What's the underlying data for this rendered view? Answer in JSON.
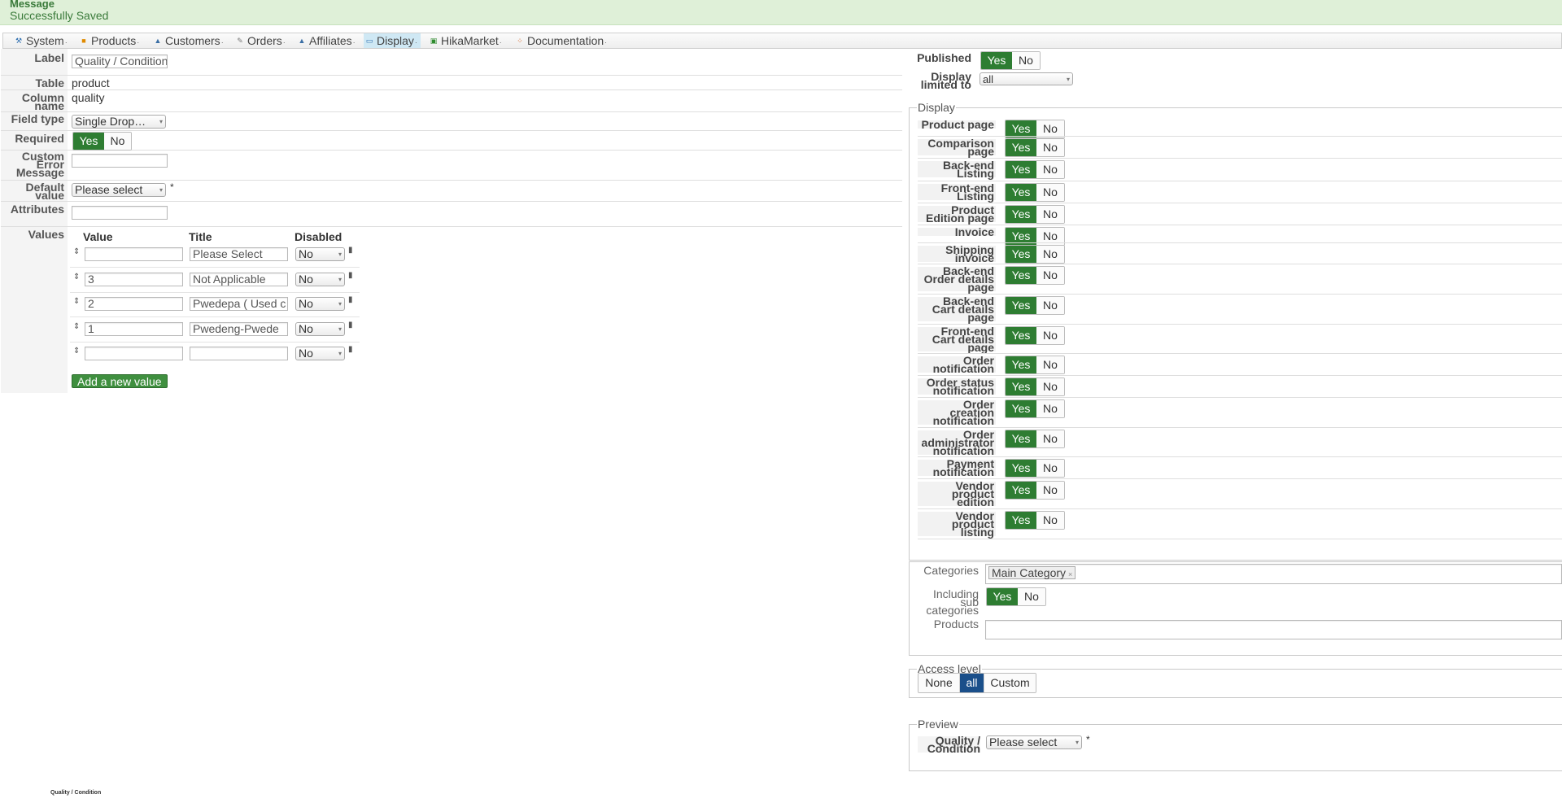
{
  "message": {
    "title": "Message",
    "text": "Successfully Saved"
  },
  "menu": [
    {
      "label": "System",
      "icon": "wrench-icon",
      "glyph": "⚒"
    },
    {
      "label": "Products",
      "icon": "box-icon",
      "glyph": "■"
    },
    {
      "label": "Customers",
      "icon": "user-icon",
      "glyph": "▲"
    },
    {
      "label": "Orders",
      "icon": "pencil-icon",
      "glyph": "✎"
    },
    {
      "label": "Affiliates",
      "icon": "people-icon",
      "glyph": "▲"
    },
    {
      "label": "Display",
      "icon": "monitor-icon",
      "glyph": "▭"
    },
    {
      "label": "HikaMarket",
      "icon": "market-icon",
      "glyph": "▣"
    },
    {
      "label": "Documentation",
      "icon": "help-icon",
      "glyph": "⁘"
    }
  ],
  "form": {
    "label_label": "Label",
    "label_value": "Quality / Condition",
    "table_label": "Table",
    "table_value": "product",
    "column_label_1": "Column",
    "column_label_2": "name",
    "column_value": "quality",
    "fieldtype_label": "Field type",
    "fieldtype_value": "Single Drop…",
    "required_label": "Required",
    "yes": "Yes",
    "no": "No",
    "custom_error_1": "Custom",
    "custom_error_2": "Error",
    "custom_error_3": "Message",
    "default_label_1": "Default",
    "default_label_2": "value",
    "default_value": "Please select",
    "required_star": "*",
    "attributes_label": "Attributes",
    "values_label": "Values"
  },
  "values_table": {
    "headers": [
      "Value",
      "Title",
      "Disabled"
    ],
    "rows": [
      {
        "value": "",
        "title": "Please Select",
        "disabled": "No"
      },
      {
        "value": "3",
        "title": "Not Applicable",
        "disabled": "No"
      },
      {
        "value": "2",
        "title": "Pwedepa ( Used c",
        "disabled": "No"
      },
      {
        "value": "1",
        "title": "Pwedeng-Pwede",
        "disabled": "No"
      },
      {
        "value": "",
        "title": "",
        "disabled": "No"
      }
    ],
    "add_button": "Add a new value"
  },
  "right": {
    "published_label": "Published",
    "display_limited_1": "Display",
    "display_limited_2": "limited to",
    "display_limited_value": "all",
    "display_legend": "Display",
    "display_rows": [
      {
        "l1": "Product page",
        "l2": "",
        "l3": ""
      },
      {
        "l1": "Comparison",
        "l2": "page",
        "l3": ""
      },
      {
        "l1": "Back-end",
        "l2": "Listing",
        "l3": ""
      },
      {
        "l1": "Front-end",
        "l2": "Listing",
        "l3": ""
      },
      {
        "l1": "Product",
        "l2": "Edition page",
        "l3": ""
      },
      {
        "l1": "Invoice",
        "l2": "",
        "l3": ""
      },
      {
        "l1": "Shipping",
        "l2": "invoice",
        "l3": ""
      },
      {
        "l1": "Back-end",
        "l2": "Order details",
        "l3": "page"
      },
      {
        "l1": "Back-end",
        "l2": "Cart details",
        "l3": "page"
      },
      {
        "l1": "Front-end",
        "l2": "Cart details",
        "l3": "page"
      },
      {
        "l1": "Order",
        "l2": "notification",
        "l3": ""
      },
      {
        "l1": "Order status",
        "l2": "notification",
        "l3": ""
      },
      {
        "l1": "Order",
        "l2": "creation",
        "l3": "notification"
      },
      {
        "l1": "Order",
        "l2": "administrator",
        "l3": "notification"
      },
      {
        "l1": "Payment",
        "l2": "notification",
        "l3": ""
      },
      {
        "l1": "Vendor",
        "l2": "product",
        "l3": "edition"
      },
      {
        "l1": "Vendor",
        "l2": "product",
        "l3": "listing"
      }
    ],
    "categories_label": "Categories",
    "categories_tag": "Main Category",
    "including_1": "Including",
    "including_2": "sub",
    "including_3": "categories",
    "products_label": "Products",
    "access_legend": "Access level",
    "access_options": [
      "None",
      "all",
      "Custom"
    ],
    "preview_legend": "Preview",
    "preview_label_1": "Quality /",
    "preview_label_2": "Condition",
    "preview_value": "Please select",
    "preview_star": "*"
  },
  "footer_caption": "Quality / Condition"
}
